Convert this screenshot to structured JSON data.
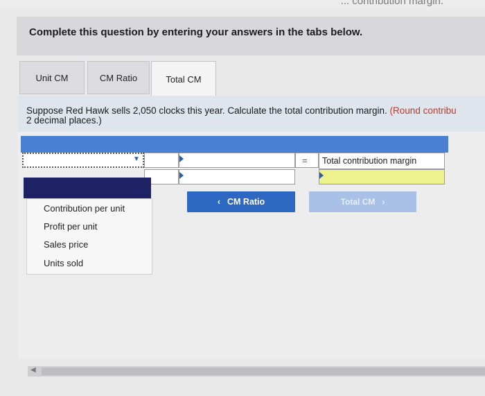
{
  "top_fragment": "... contribution margin.",
  "header": {
    "text": "Complete this question by entering your answers in the tabs below."
  },
  "tabs": [
    {
      "label": "Unit CM",
      "active": false
    },
    {
      "label": "CM Ratio",
      "active": false
    },
    {
      "label": "Total CM",
      "active": true
    }
  ],
  "instructions": {
    "line1_main": "Suppose Red Hawk sells 2,050 clocks this year. Calculate the total contribution margin.",
    "line1_note": "(Round contribu",
    "line2": "2 decimal places.)"
  },
  "table": {
    "equals": "=",
    "result_label": "Total contribution margin"
  },
  "nav": {
    "prev_label": "CM Ratio",
    "next_label": "Total CM"
  },
  "dropdown": {
    "options": [
      "Contribution per unit",
      "Profit per unit",
      "Sales price",
      "Units sold"
    ]
  },
  "colors": {
    "table_header": "#4a7fd3",
    "nav_primary": "#2c68c2",
    "nav_disabled": "#a9c1e6",
    "dropdown_highlight": "#1c2263",
    "result_cell": "#eef28d"
  }
}
